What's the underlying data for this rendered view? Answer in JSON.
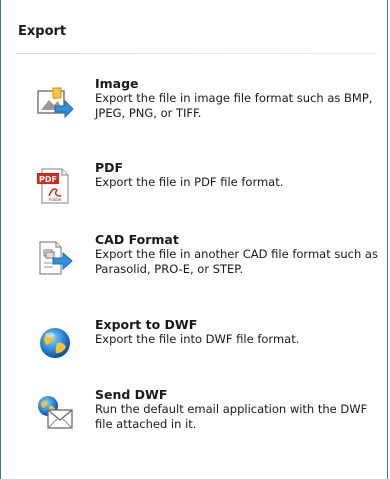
{
  "panel": {
    "title": "Export"
  },
  "items": [
    {
      "title": "Image",
      "description": "Export the file in image file format such as BMP, JPEG, PNG, or TIFF.",
      "icon": "image-export-icon"
    },
    {
      "title": "PDF",
      "description": "Export the file in PDF file format.",
      "icon": "pdf-icon",
      "icon_badge": "PDF",
      "icon_brand": "Adobe"
    },
    {
      "title": "CAD Format",
      "description": "Export the file in another CAD file format such as Parasolid, PRO-E, or STEP.",
      "icon": "cad-export-icon"
    },
    {
      "title": "Export to DWF",
      "description": "Export the file into DWF file format.",
      "icon": "dwf-globe-icon"
    },
    {
      "title": "Send DWF",
      "description": "Run the default email application with the DWF file attached in it.",
      "icon": "send-dwf-mail-icon"
    }
  ],
  "colors": {
    "panel_border": "#2f6fb5",
    "divider": "#d9d9d9",
    "arrow_blue": "#2f8fde",
    "pdf_red": "#d7261d"
  }
}
